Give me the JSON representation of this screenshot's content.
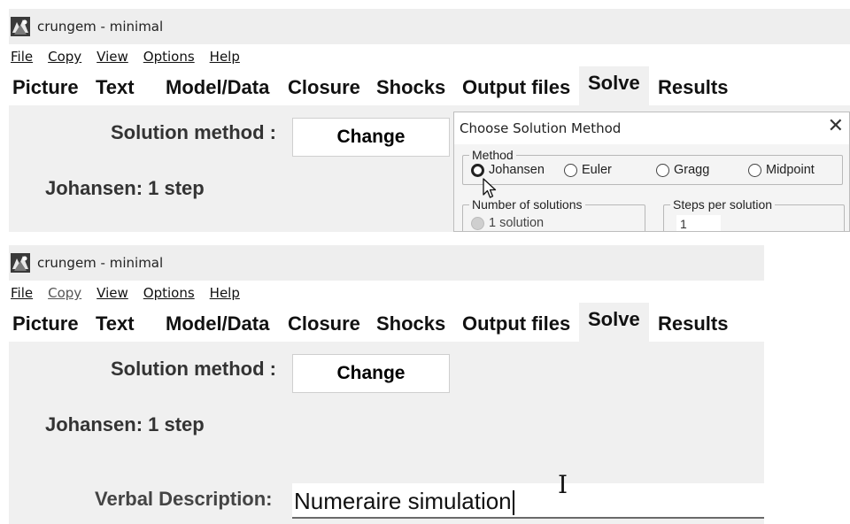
{
  "top_window": {
    "title": "crungem - minimal",
    "menu": [
      {
        "label": "File"
      },
      {
        "label": "Copy"
      },
      {
        "label": "View"
      },
      {
        "label": "Options"
      },
      {
        "label": "Help"
      }
    ],
    "tabs": [
      "Picture",
      "Text",
      "Model/Data",
      "Closure",
      "Shocks",
      "Output files",
      "Solve",
      "Results"
    ],
    "active_tab": "Solve",
    "solution_method_label": "Solution method :",
    "change_button": "Change",
    "method_summary": "Johansen: 1 step"
  },
  "dialog": {
    "title": "Choose Solution Method",
    "close_glyph": "✕",
    "method_group_label": "Method",
    "methods": [
      {
        "label": "Johansen",
        "checked": true
      },
      {
        "label": "Euler",
        "checked": false
      },
      {
        "label": "Gragg",
        "checked": false
      },
      {
        "label": "Midpoint",
        "checked": false
      }
    ],
    "num_solutions_label": "Number of solutions",
    "num_solutions_option": "1 solution",
    "steps_label": "Steps per solution",
    "steps_value": "1"
  },
  "bottom_window": {
    "title": "crungem - minimal",
    "menu": [
      {
        "label": "File"
      },
      {
        "label": "Copy"
      },
      {
        "label": "View"
      },
      {
        "label": "Options"
      },
      {
        "label": "Help"
      }
    ],
    "tabs": [
      "Picture",
      "Text",
      "Model/Data",
      "Closure",
      "Shocks",
      "Output files",
      "Solve",
      "Results"
    ],
    "active_tab": "Solve",
    "solution_method_label": "Solution method :",
    "change_button": "Change",
    "method_summary": "Johansen: 1 step",
    "verbal_label": "Verbal Description:",
    "verbal_value": "Numeraire simulation"
  },
  "icons": {
    "app": "app-logo-icon",
    "cursor_arrow": "mouse-pointer-icon",
    "cursor_ibeam": "text-cursor-icon"
  }
}
